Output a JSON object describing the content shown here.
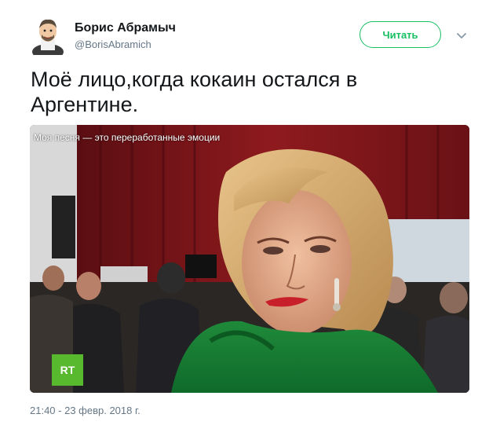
{
  "author": {
    "name": "Борис Абрамыч",
    "handle": "@BorisAbramich"
  },
  "actions": {
    "follow_label": "Читать"
  },
  "tweet": {
    "text": "Моё лицо,когда кокаин остался в Аргентине."
  },
  "media": {
    "caption": "Моя песня — это переработанные эмоции",
    "channel_logo": "RT"
  },
  "meta": {
    "timestamp": "21:40 - 23 февр. 2018 г."
  },
  "colors": {
    "accent": "#17bf63",
    "secondary_text": "#657786"
  },
  "icons": {
    "caret": "chevron-down-icon"
  }
}
